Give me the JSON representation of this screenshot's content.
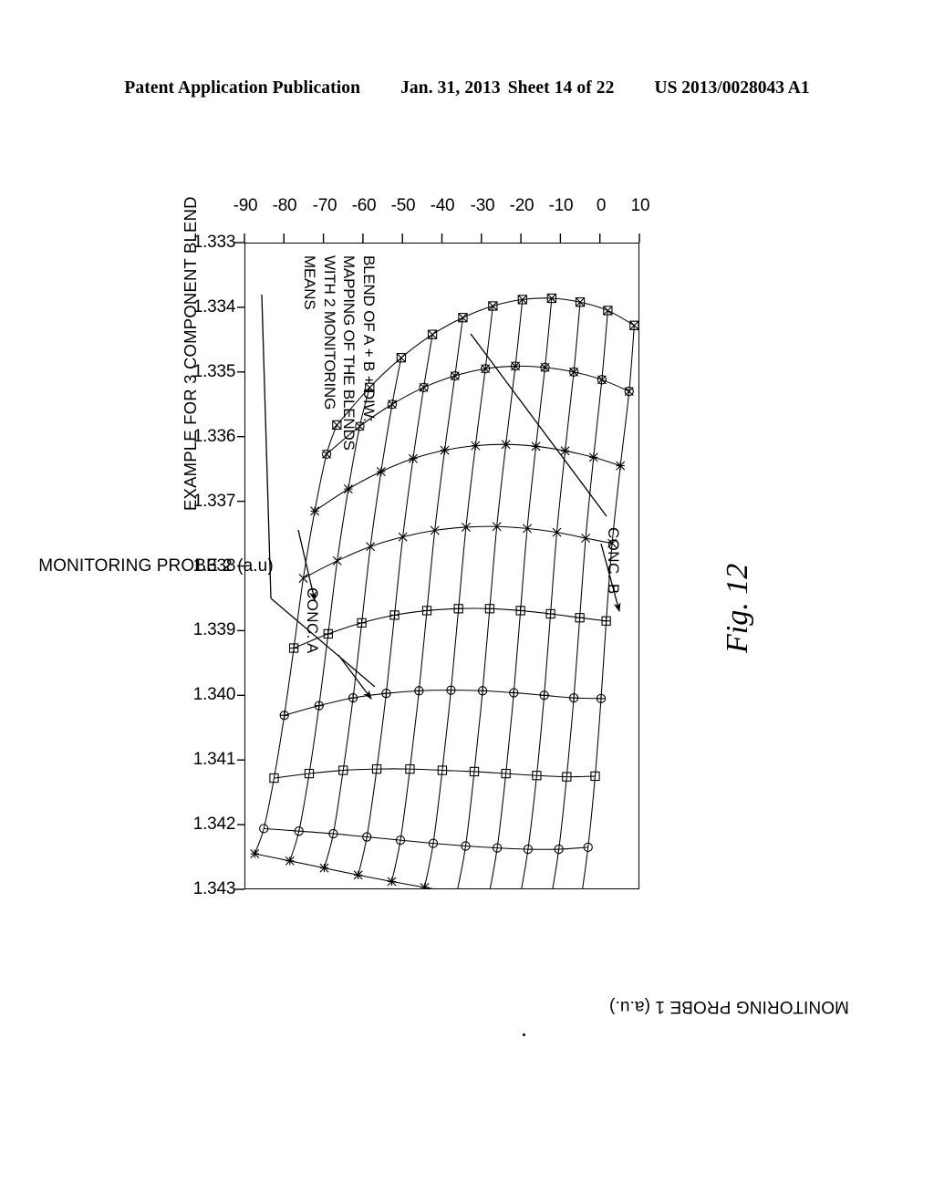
{
  "header": {
    "publication": "Patent Application Publication",
    "date": "Jan. 31, 2013",
    "sheet": "Sheet 14 of 22",
    "number": "US 2013/0028043 A1"
  },
  "figure": {
    "caption": "Fig. 12",
    "main_title": "EXAMPLE FOR 3 COMPONENT BLEND",
    "annotation_block": "BLEND OF A + B + DIW:\nMAPPING OF THE BLENDS\nWITH 2 MONITORING\nMEANS",
    "direction_labels": {
      "conc_a": "CONC. A",
      "conc_b": "CONC. B"
    }
  },
  "chart_data": {
    "type": "scatter",
    "title": "EXAMPLE FOR 3 COMPONENT BLEND",
    "subtitle": "BLEND OF A + B + DIW: MAPPING OF THE BLENDS WITH 2 MONITORING MEANS",
    "xlabel": "MONITORING PROBE 2 (a.u)",
    "ylabel": "MONITORING PROBE 1 (a.u.)",
    "xlim": [
      1.333,
      1.343
    ],
    "ylim": [
      -90,
      10
    ],
    "xticks": [
      "1.333",
      "1.334",
      "1.335",
      "1.336",
      "1.337",
      "1.338",
      "1.339",
      "1.340",
      "1.341",
      "1.342",
      "1.343"
    ],
    "yticks": [
      "10",
      "0",
      "-10",
      "-20",
      "-30",
      "-40",
      "-50",
      "-60",
      "-70",
      "-80",
      "-90"
    ],
    "grid": false,
    "legend": "none",
    "annotations": [
      {
        "text": "CONC. A",
        "kind": "direction-arrow"
      },
      {
        "text": "CONC. B",
        "kind": "direction-arrow"
      }
    ],
    "description": "Curvilinear mesh (grid of blend compositions) mapped into the plane of two monitoring probe readings. Rows correspond to increasing concentration of component B, columns to increasing concentration of component A.",
    "mesh_rows": [
      [
        [
          1.33428,
          8.7
        ],
        [
          1.3353,
          7.4
        ],
        [
          1.33645,
          5.2
        ],
        [
          1.33765,
          3.1
        ],
        [
          1.33885,
          1.6
        ],
        [
          1.34005,
          0.3
        ],
        [
          1.34125,
          -1.2
        ],
        [
          1.34235,
          -3.0
        ],
        [
          1.34325,
          -5.0
        ]
      ],
      [
        [
          1.33405,
          2.0
        ],
        [
          1.33512,
          0.5
        ],
        [
          1.33632,
          -1.6
        ],
        [
          1.33757,
          -3.6
        ],
        [
          1.3388,
          -5.1
        ],
        [
          1.34004,
          -6.6
        ],
        [
          1.34126,
          -8.4
        ],
        [
          1.34238,
          -10.4
        ],
        [
          1.34322,
          -12.6
        ]
      ],
      [
        [
          1.33392,
          -5.0
        ],
        [
          1.335,
          -6.6
        ],
        [
          1.33622,
          -8.8
        ],
        [
          1.33748,
          -10.9
        ],
        [
          1.33874,
          -12.5
        ],
        [
          1.34,
          -14.1
        ],
        [
          1.34124,
          -16.0
        ],
        [
          1.34238,
          -18.2
        ],
        [
          1.34318,
          -20.4
        ]
      ],
      [
        [
          1.33386,
          -12.2
        ],
        [
          1.33493,
          -13.9
        ],
        [
          1.33615,
          -16.2
        ],
        [
          1.33742,
          -18.4
        ],
        [
          1.33869,
          -20.1
        ],
        [
          1.33996,
          -21.8
        ],
        [
          1.34121,
          -23.8
        ],
        [
          1.34236,
          -26.0
        ],
        [
          1.34312,
          -28.2
        ]
      ],
      [
        [
          1.33388,
          -19.6
        ],
        [
          1.33491,
          -21.4
        ],
        [
          1.33612,
          -23.8
        ],
        [
          1.33739,
          -26.1
        ],
        [
          1.33866,
          -27.9
        ],
        [
          1.33993,
          -29.7
        ],
        [
          1.34118,
          -31.8
        ],
        [
          1.34233,
          -34.0
        ],
        [
          1.34305,
          -36.2
        ]
      ],
      [
        [
          1.33398,
          -27.1
        ],
        [
          1.33495,
          -29.0
        ],
        [
          1.33614,
          -31.5
        ],
        [
          1.3374,
          -33.9
        ],
        [
          1.33866,
          -35.8
        ],
        [
          1.33992,
          -37.7
        ],
        [
          1.34116,
          -39.9
        ],
        [
          1.34229,
          -42.2
        ],
        [
          1.34297,
          -44.4
        ]
      ],
      [
        [
          1.33416,
          -34.7
        ],
        [
          1.33506,
          -36.7
        ],
        [
          1.33621,
          -39.3
        ],
        [
          1.33745,
          -41.8
        ],
        [
          1.33869,
          -43.8
        ],
        [
          1.33993,
          -45.8
        ],
        [
          1.34114,
          -48.1
        ],
        [
          1.34224,
          -50.5
        ],
        [
          1.34288,
          -52.7
        ]
      ],
      [
        [
          1.33442,
          -42.4
        ],
        [
          1.33524,
          -44.6
        ],
        [
          1.33634,
          -47.3
        ],
        [
          1.33755,
          -49.9
        ],
        [
          1.33876,
          -52.0
        ],
        [
          1.33997,
          -54.1
        ],
        [
          1.34114,
          -56.5
        ],
        [
          1.34219,
          -59.0
        ],
        [
          1.34278,
          -61.2
        ]
      ],
      [
        [
          1.33478,
          -50.3
        ],
        [
          1.3355,
          -52.6
        ],
        [
          1.33654,
          -55.4
        ],
        [
          1.3377,
          -58.1
        ],
        [
          1.33888,
          -60.3
        ],
        [
          1.34004,
          -62.5
        ],
        [
          1.34116,
          -65.0
        ],
        [
          1.34214,
          -67.5
        ],
        [
          1.34267,
          -69.8
        ]
      ],
      [
        [
          1.33524,
          -58.3
        ],
        [
          1.33584,
          -60.8
        ],
        [
          1.33681,
          -63.7
        ],
        [
          1.33792,
          -66.5
        ],
        [
          1.33905,
          -68.8
        ],
        [
          1.34016,
          -71.1
        ],
        [
          1.34121,
          -73.6
        ],
        [
          1.3421,
          -76.2
        ],
        [
          1.34256,
          -78.5
        ]
      ],
      [
        [
          1.33582,
          -66.6
        ],
        [
          1.33627,
          -69.2
        ],
        [
          1.33715,
          -72.2
        ],
        [
          1.33819,
          -75.1
        ],
        [
          1.33927,
          -77.5
        ],
        [
          1.34031,
          -79.9
        ],
        [
          1.34128,
          -82.5
        ],
        [
          1.34206,
          -85.1
        ],
        [
          1.34245,
          -87.4
        ]
      ]
    ],
    "marker_styles": [
      "square-x",
      "circle-x",
      "asterisk",
      "cross",
      "plus-square",
      "circle-plus",
      "open-square",
      "open-circle",
      "star"
    ]
  },
  "axes": {
    "x_axis_title": "MONITORING PROBE 2 (a.u)",
    "y_axis_title": "MONITORING PROBE 1 (a.u.)",
    "x_tick_labels": [
      "1.333",
      "1.334",
      "1.335",
      "1.336",
      "1.337",
      "1.338",
      "1.339",
      "1.340",
      "1.341",
      "1.342",
      "1.343"
    ],
    "y_tick_labels": [
      "10",
      "0",
      "-10",
      "-20",
      "-30",
      "-40",
      "-50",
      "-60",
      "-70",
      "-80",
      "-90"
    ]
  }
}
